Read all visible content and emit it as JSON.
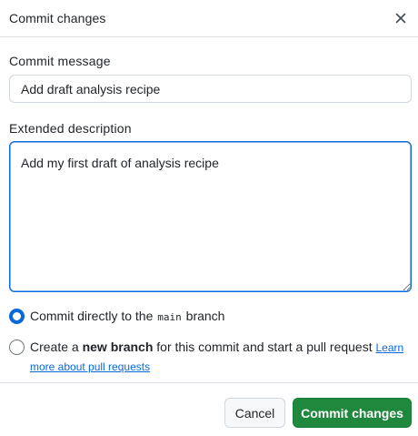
{
  "dialog": {
    "title": "Commit changes",
    "close_icon": "x-icon"
  },
  "form": {
    "commit_message_label": "Commit message",
    "commit_message_value": "Add draft analysis recipe",
    "extended_description_label": "Extended description",
    "extended_description_value": "Add my first draft of analysis recipe"
  },
  "options": {
    "direct": {
      "prefix": "Commit directly to the ",
      "branch": "main",
      "suffix": " branch",
      "selected": true
    },
    "new_branch": {
      "prefix": "Create a ",
      "bold": "new branch",
      "suffix": " for this commit and start a pull request ",
      "link": "Learn more about pull requests",
      "selected": false
    }
  },
  "buttons": {
    "cancel": "Cancel",
    "commit": "Commit changes"
  },
  "colors": {
    "accent": "#0969da",
    "primary_button": "#1f883d",
    "border": "#d0d7de"
  }
}
